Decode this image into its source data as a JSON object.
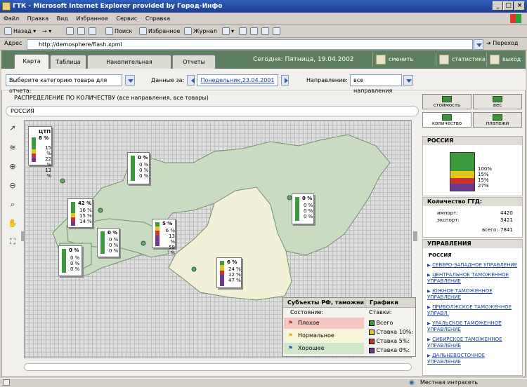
{
  "window": {
    "title": "ГТК - Microsoft Internet Explorer provided by Город-Инфо",
    "min": "_",
    "max": "□",
    "close": "×"
  },
  "menu": [
    "Файл",
    "Правка",
    "Вид",
    "Избранное",
    "Сервис",
    "Справка"
  ],
  "toolbar": {
    "back": "Назад",
    "search": "Поиск",
    "favorites": "Избранное",
    "journal": "Журнал"
  },
  "address": {
    "label": "Адрес",
    "url": "http://demosphere/flash.xpml",
    "go": "Переход"
  },
  "tabs": [
    "Карта",
    "Таблица",
    "Накопительная информация",
    "Отчеты"
  ],
  "header": {
    "date": "Сегодня: Пятница, 19.04.2002",
    "change_password": "сменить пароль",
    "statistics": "статистика",
    "exit": "выход"
  },
  "filters": {
    "category_value": "Выберите категорию товара для отчета:",
    "data_for_label": "Данные за:",
    "date_link": "Понедельник,23.04.2001",
    "direction_label": "Направление:",
    "direction_value": "все направления"
  },
  "distribution_title": "РАСПРЕДЕЛЕНИЕ ПО КОЛИЧЕСТВУ (все направления, все товары)",
  "region_name": "РОССИЯ",
  "map_boxes": [
    {
      "title": "ЦТП",
      "main": "8 %",
      "values": [
        "15 %",
        "22 %",
        "13 %"
      ]
    },
    {
      "title": "",
      "main": "0 %",
      "values": [
        "0 %",
        "0 %",
        "0 %"
      ]
    },
    {
      "title": "",
      "main": "42 %",
      "values": [
        "16 %",
        "15 %",
        "14 %"
      ]
    },
    {
      "title": "",
      "main": "0 %",
      "values": [
        "0 %",
        "0 %",
        "0 %"
      ]
    },
    {
      "title": "",
      "main": "5 %",
      "values": [
        "6 %",
        "13 %",
        "59 %"
      ]
    },
    {
      "title": "",
      "main": "0 %",
      "values": [
        "0 %",
        "0 %",
        "0 %"
      ]
    },
    {
      "title": "",
      "main": "0 %",
      "values": [
        "0 %",
        "0 %",
        "0 %"
      ]
    },
    {
      "title": "",
      "main": "6 %",
      "values": [
        "24 %",
        "12 %",
        "47 %"
      ]
    }
  ],
  "legend": {
    "subjects_title": "Субъекты РФ, таможни",
    "state_label": "Состояние:",
    "states": [
      "Плохое",
      "Нормальное",
      "Хорошее"
    ],
    "graphs_title": "Графики",
    "rates_label": "Ставки:",
    "rates": [
      "Всего",
      "Ставка 10%:",
      "Ставка 5%:",
      "Ставка 0%:"
    ]
  },
  "right_buttons": [
    "стоимость",
    "вес",
    "количество",
    "платежи"
  ],
  "russia_panel": {
    "title": "РОССИЯ",
    "values": [
      "100%",
      "15%",
      "15%",
      "27%"
    ]
  },
  "gtd_panel": {
    "title": "Количество ГТД:",
    "import_label": "импорт:",
    "import_value": "4420",
    "export_label": "экспорт:",
    "export_value": "3421",
    "total_label": "всего:",
    "total_value": "7841"
  },
  "management": {
    "title": "УПРАВЛЕНИЯ",
    "subtitle": "РОССИЯ",
    "links": [
      "СЕВЕРО-ЗАПАДНОЕ УПРАВЛЕНИЕ",
      "ЦЕНТРАЛЬНОЕ ТАМОЖЕННОЕ УПРАВЛЕНИЕ",
      "ЮЖНОЕ ТАМОЖЕННОЕ УПРАВЛЕНИЕ",
      "ПРИВОЛЖСКОЕ ТАМОЖЕННОЕ УПРАВЛ.",
      "УРАЛЬСКОЕ ТАМОЖЕННОЕ УПРАВЛЕНИЕ",
      "СИБИРСКОЕ ТАМОЖЕННОЕ УПРАВЛЕНИЕ",
      "ДАЛЬНЕВОСТОЧНОЕ УПРАВЛЕНИЕ"
    ]
  },
  "status": {
    "zone": "Местная интрасеть"
  },
  "colors": {
    "green": "#3c9a3c",
    "yellow": "#e4c51a",
    "red": "#c8332e",
    "purple": "#6b3a8e",
    "map_green": "#c9dcc2",
    "map_yellow": "#f2f1d8",
    "bad": "#f6c5bf",
    "normal": "#f7f5d6",
    "good": "#cfe6c8"
  }
}
